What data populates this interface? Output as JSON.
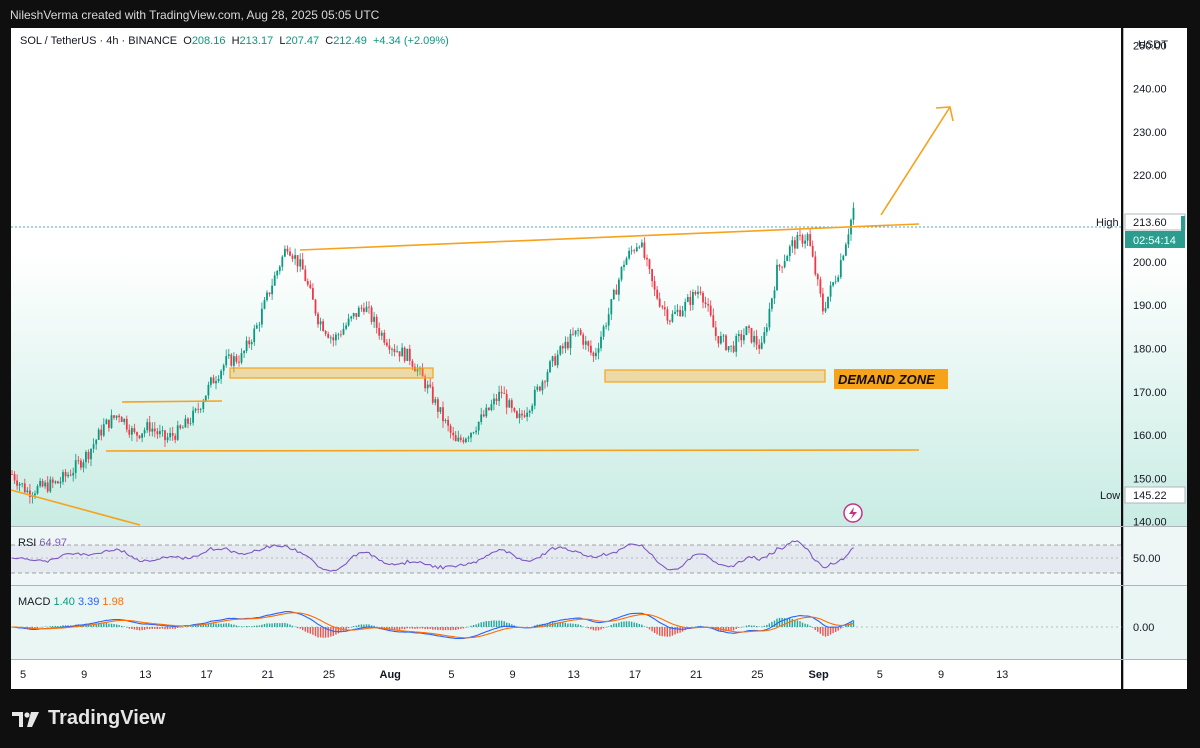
{
  "credit": "NileshVerma created with TradingView.com, Aug 28, 2025 05:05 UTC",
  "header": {
    "symbol": "SOL / TetherUS · 4h · BINANCE",
    "o_label": "O",
    "o": "208.16",
    "h_label": "H",
    "h": "213.17",
    "l_label": "L",
    "l": "207.47",
    "c_label": "C",
    "c": "212.49",
    "change": "+4.34 (+2.09%)"
  },
  "axis": {
    "currency": "USDT",
    "high_label": "High",
    "high_value": "213.60",
    "countdown": "02:54:14",
    "low_label": "Low",
    "low_value": "145.22",
    "rsi_level": "50.00",
    "macd_level": "0.00"
  },
  "annotations": {
    "demand_zone": "DEMAND ZONE"
  },
  "rsi": {
    "label": "RSI",
    "value": "64.97"
  },
  "macd": {
    "label": "MACD",
    "v1": "1.40",
    "v2": "3.39",
    "v3": "1.98"
  },
  "brand": {
    "name": "TradingView"
  },
  "colors": {
    "up": "#089981",
    "down": "#f23645",
    "orange": "#f7a21b",
    "rsi": "#7e57c2",
    "macd": "#2962ff",
    "signal": "#ff6d00"
  },
  "chart_data": {
    "type": "candlestick",
    "title": "SOL / TetherUS · 4h · BINANCE",
    "y_ticks": [
      "250.00",
      "240.00",
      "230.00",
      "220.00",
      "200.00",
      "190.00",
      "180.00",
      "170.00",
      "160.00",
      "150.00",
      "140.00"
    ],
    "x_ticks": [
      "5",
      "9",
      "13",
      "17",
      "21",
      "25",
      "Aug",
      "5",
      "9",
      "13",
      "17",
      "21",
      "25",
      "Sep",
      "5",
      "9",
      "13"
    ],
    "close_path": [
      [
        "Jul 4",
        151
      ],
      [
        "Jul 5",
        147
      ],
      [
        "Jul 6",
        148
      ],
      [
        "Jul 7",
        149
      ],
      [
        "Jul 8",
        152
      ],
      [
        "Jul 9",
        156
      ],
      [
        "Jul 10",
        162
      ],
      [
        "Jul 11",
        165
      ],
      [
        "Jul 12",
        160
      ],
      [
        "Jul 13",
        162
      ],
      [
        "Jul 14",
        159
      ],
      [
        "Jul 15",
        161
      ],
      [
        "Jul 16",
        165
      ],
      [
        "Jul 17",
        172
      ],
      [
        "Jul 18",
        177
      ],
      [
        "Jul 19",
        178
      ],
      [
        "Jul 20",
        185
      ],
      [
        "Jul 21",
        195
      ],
      [
        "Jul 22",
        204
      ],
      [
        "Jul 23",
        198
      ],
      [
        "Jul 24",
        187
      ],
      [
        "Jul 25",
        182
      ],
      [
        "Jul 26",
        186
      ],
      [
        "Jul 27",
        190
      ],
      [
        "Jul 28",
        184
      ],
      [
        "Jul 29",
        180
      ],
      [
        "Jul 30",
        178
      ],
      [
        "Jul 31",
        172
      ],
      [
        "Aug 1",
        165
      ],
      [
        "Aug 2",
        158
      ],
      [
        "Aug 3",
        161
      ],
      [
        "Aug 4",
        165
      ],
      [
        "Aug 5",
        170
      ],
      [
        "Aug 6",
        163
      ],
      [
        "Aug 7",
        168
      ],
      [
        "Aug 8",
        175
      ],
      [
        "Aug 9",
        180
      ],
      [
        "Aug 10",
        184
      ],
      [
        "Aug 11",
        178
      ],
      [
        "Aug 12",
        188
      ],
      [
        "Aug 13",
        200
      ],
      [
        "Aug 14",
        205
      ],
      [
        "Aug 15",
        193
      ],
      [
        "Aug 16",
        187
      ],
      [
        "Aug 17",
        190
      ],
      [
        "Aug 18",
        194
      ],
      [
        "Aug 19",
        183
      ],
      [
        "Aug 20",
        180
      ],
      [
        "Aug 21",
        184
      ],
      [
        "Aug 22",
        180
      ],
      [
        "Aug 23",
        198
      ],
      [
        "Aug 24",
        204
      ],
      [
        "Aug 25",
        206
      ],
      [
        "Aug 26",
        189
      ],
      [
        "Aug 27",
        198
      ],
      [
        "Aug 28",
        212
      ]
    ],
    "y_range": [
      139,
      254
    ],
    "levels": {
      "high": 213.6,
      "low": 145.22
    }
  }
}
